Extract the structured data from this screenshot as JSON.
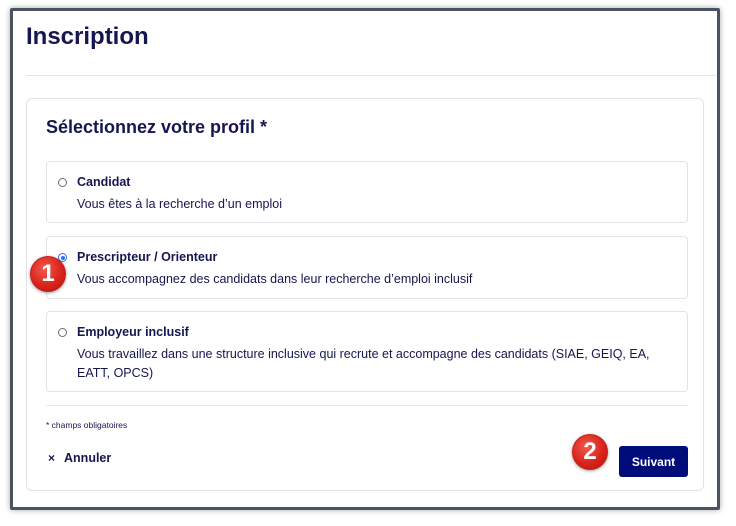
{
  "page": {
    "title": "Inscription"
  },
  "form": {
    "section_title": "Sélectionnez votre profil *",
    "options": [
      {
        "label": "Candidat",
        "description": "Vous êtes à la recherche d’un emploi",
        "selected": false
      },
      {
        "label": "Prescripteur / Orienteur",
        "description": "Vous accompagnez des candidats dans leur recherche d’emploi inclusif",
        "selected": true
      },
      {
        "label": "Employeur inclusif",
        "description": "Vous travaillez dans une structure inclusive qui recrute et accompagne des candidats (SIAE, GEIQ, EA, EATT, OPCS)",
        "selected": false
      }
    ],
    "required_note": "* champs obligatoires",
    "cancel_icon": "×",
    "cancel_label": "Annuler",
    "next_label": "Suivant"
  },
  "annotations": {
    "badge_1": "1",
    "badge_2": "2"
  },
  "colors": {
    "primary": "#000c7a",
    "text": "#161650",
    "radio_selected": "#2d6ff0",
    "badge": "#d8241c"
  }
}
